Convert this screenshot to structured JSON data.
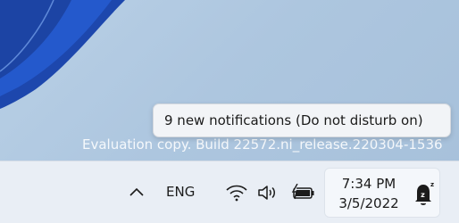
{
  "watermark": "Evaluation copy. Build 22572.ni_release.220304-1536",
  "tooltip": {
    "text": "9 new notifications (Do not disturb on)"
  },
  "tray": {
    "language": "ENG",
    "icons": [
      "chevron-up-icon",
      "wifi-icon",
      "volume-icon",
      "battery-charging-icon"
    ]
  },
  "clock": {
    "time": "7:34 PM",
    "date": "3/5/2022"
  },
  "notifications": {
    "icon": "bell-snooze-icon",
    "badge": "z",
    "badge_small": "z"
  },
  "colors": {
    "taskbar": "#e9eef5",
    "wallpaper": "#aec6de",
    "bloom": "#1f4fb8"
  }
}
